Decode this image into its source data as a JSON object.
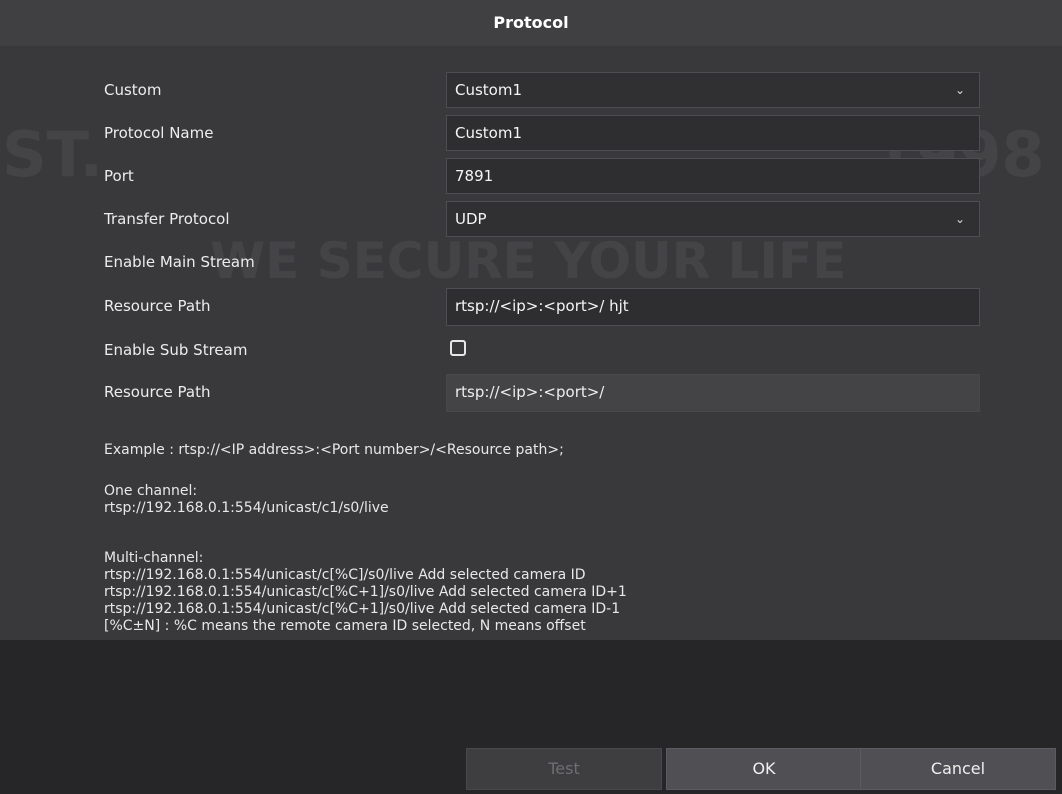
{
  "dialog": {
    "title": "Protocol"
  },
  "form": {
    "custom": {
      "label": "Custom",
      "value": "Custom1"
    },
    "protocol_name": {
      "label": "Protocol Name",
      "value": "Custom1"
    },
    "port": {
      "label": "Port",
      "value": "7891"
    },
    "transfer_protocol": {
      "label": "Transfer Protocol",
      "value": "UDP"
    },
    "enable_main_stream": {
      "label": "Enable Main Stream"
    },
    "main_resource_path": {
      "label": "Resource Path",
      "value": "rtsp://<ip>:<port>/ hjt"
    },
    "enable_sub_stream": {
      "label": "Enable Sub Stream",
      "checked": false
    },
    "sub_resource_path": {
      "label": "Resource Path",
      "value": "rtsp://<ip>:<port>/"
    }
  },
  "help": {
    "example": "Example : rtsp://<IP address>:<Port number>/<Resource path>;",
    "one_channel_title": "One channel:",
    "one_channel_line": "rtsp://192.168.0.1:554/unicast/c1/s0/live",
    "multi_title": "Multi-channel:",
    "multi_line1": "rtsp://192.168.0.1:554/unicast/c[%C]/s0/live Add selected camera ID",
    "multi_line2": "rtsp://192.168.0.1:554/unicast/c[%C+1]/s0/live Add selected camera ID+1",
    "multi_line3": "rtsp://192.168.0.1:554/unicast/c[%C+1]/s0/live Add selected camera ID-1",
    "multi_line4": "[%C±N] : %C means the remote camera ID selected, N means offset"
  },
  "buttons": {
    "test": "Test",
    "ok": "OK",
    "cancel": "Cancel"
  },
  "watermark": {
    "left": "ST.",
    "right": "1998",
    "slogan": "WE SECURE YOUR LIFE"
  },
  "icons": {
    "dropdown": "chevron-down-icon"
  }
}
